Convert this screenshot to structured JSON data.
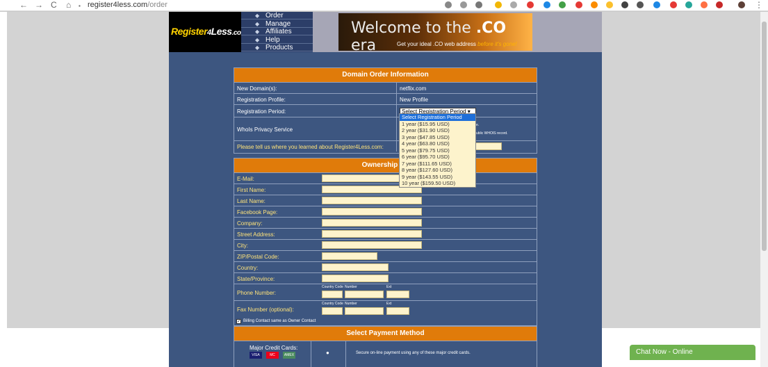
{
  "browser": {
    "url_domain": "register4less.com",
    "url_path": "/order",
    "nav": {
      "back": "←",
      "forward": "→",
      "reload": "C",
      "home": "⌂",
      "lock": "🔒"
    }
  },
  "site": {
    "logo": {
      "register": "Register",
      "four": "4",
      "less": "Less",
      "com": ".com"
    },
    "menu": [
      "Order",
      "Manage",
      "Affiliates",
      "Help",
      "Products"
    ],
    "banner": {
      "title_pre": "Welcome to the",
      "title_co": ".CO",
      "title_post": "era",
      "subtitle": "Get your ideal .CO web address",
      "subtitle_em": "before it's gone!"
    }
  },
  "domain_order": {
    "heading": "Domain Order Information",
    "rows": [
      {
        "label": "New Domain(s):",
        "value": "netflix.com"
      },
      {
        "label": "Registration Profile:",
        "value": "New Profile"
      },
      {
        "label": "Registration Period:",
        "value": "Select Registration Period ▾"
      },
      {
        "label": "WhoIs Privacy Service",
        "value": ""
      },
      {
        "label": "Please tell us where you learned about Register4Less.com:",
        "value": ""
      }
    ],
    "whois_note_1": "e.",
    "whois_note_2": "ublic WHOIS record.",
    "dropdown_options": [
      "Select Registration Period",
      "1 year ($15.95 USD)",
      "2 year ($31.90 USD)",
      "3 year ($47.85 USD)",
      "4 year ($63.80 USD)",
      "5 year ($79.75 USD)",
      "6 year ($95.70 USD)",
      "7 year ($111.65 USD)",
      "8 year ($127.60 USD)",
      "9 year ($143.55 USD)",
      "10 year ($159.50 USD)"
    ]
  },
  "ownership": {
    "heading": "Ownership Co",
    "fields": [
      "E-Mail:",
      "First Name:",
      "Last Name:",
      "Facebook Page:",
      "Company:",
      "Street Address:",
      "City:",
      "ZIP/Postal Code:",
      "Country:",
      "State/Province:",
      "Phone Number:",
      "Fax Number (optional):"
    ],
    "phone_sublabels": {
      "country": "Country Code",
      "number": "Number",
      "ext": "Ext"
    }
  },
  "billing": {
    "label": "Billing Contact same as Owner Contact",
    "checked": "✓"
  },
  "payment": {
    "heading": "Select Payment Method",
    "method_label": "Major Credit Cards:",
    "method_desc": "Secure on-line payment using any of these major credit cards.",
    "radio": "●",
    "cards": [
      "VISA",
      "MC",
      "AMEX"
    ]
  },
  "chat": {
    "label": "Chat Now - Online"
  },
  "colors": {
    "accent": "#e07b0a",
    "panel": "#3d5680",
    "input": "#fdf3cc"
  }
}
